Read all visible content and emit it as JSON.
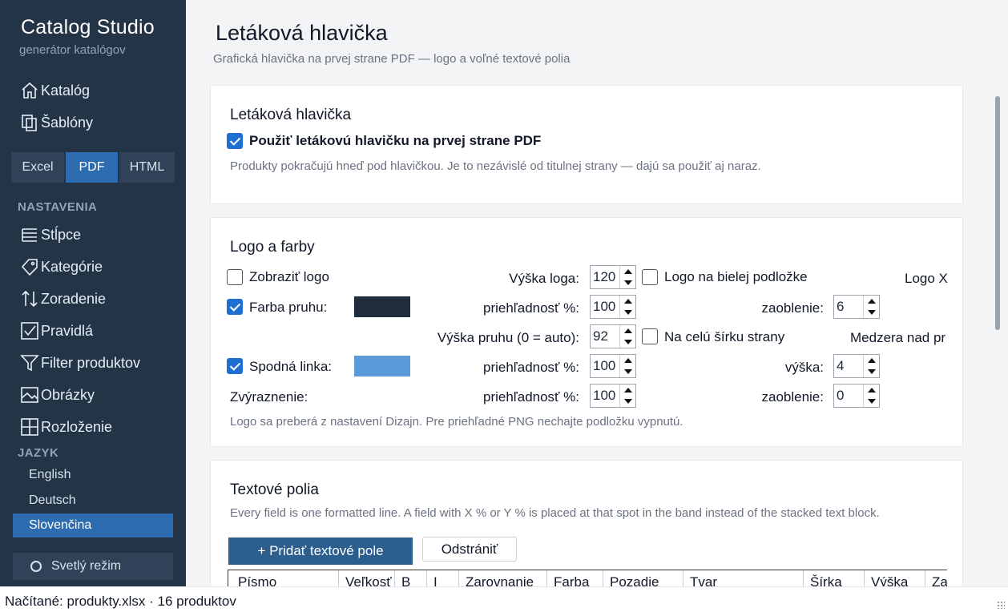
{
  "app": {
    "title": "Catalog Studio",
    "subtitle": "generátor katalógov"
  },
  "nav_top": [
    {
      "label": "Katalóg",
      "icon": "home-icon"
    },
    {
      "label": "Šablóny",
      "icon": "copy-icon"
    }
  ],
  "format_tabs": [
    {
      "label": "Excel",
      "active": false
    },
    {
      "label": "PDF",
      "active": true
    },
    {
      "label": "HTML",
      "active": false
    }
  ],
  "section_settings": "NASTAVENIA",
  "nav_settings": [
    {
      "label": "Stĺpce",
      "icon": "list-icon"
    },
    {
      "label": "Kategórie",
      "icon": "tag-icon"
    },
    {
      "label": "Zoradenie",
      "icon": "sort-icon"
    },
    {
      "label": "Pravidlá",
      "icon": "checkbox-icon"
    },
    {
      "label": "Filter produktov",
      "icon": "filter-icon"
    },
    {
      "label": "Obrázky",
      "icon": "image-icon"
    },
    {
      "label": "Rozloženie",
      "icon": "grid-icon"
    }
  ],
  "section_language": "JAZYK",
  "languages": [
    {
      "label": "English",
      "active": false
    },
    {
      "label": "Deutsch",
      "active": false
    },
    {
      "label": "Slovenčina",
      "active": true
    }
  ],
  "theme_button": "Svetlý režim",
  "page": {
    "title": "Letáková hlavička",
    "subtitle": "Grafická hlavička na prvej strane PDF — logo a voľné textové polia"
  },
  "card1": {
    "title": "Letáková hlavička",
    "checkbox_label": "Použiť letákovú hlavičku na prvej strane PDF",
    "checked": true,
    "hint": "Produkty pokračujú hneď pod hlavičkou. Je to nezávislé od titulnej strany — dajú sa použiť aj naraz."
  },
  "card2": {
    "title": "Logo a farby",
    "show_logo": {
      "label": "Zobraziť logo",
      "checked": false
    },
    "logo_height": {
      "label": "Výška loga:",
      "value": "120"
    },
    "logo_white_bg": {
      "label": "Logo na bielej podložke",
      "checked": false
    },
    "logo_x_label": "Logo X",
    "bar_color": {
      "label": "Farba pruhu:",
      "checked": true,
      "color": "#1f2d3d"
    },
    "bar_opacity": {
      "label": "priehľadnosť %:",
      "value": "100"
    },
    "bar_rounding": {
      "label": "zaoblenie:",
      "value": "6"
    },
    "bar_height": {
      "label": "Výška pruhu (0 = auto):",
      "value": "92"
    },
    "full_width": {
      "label": "Na celú šírku strany",
      "checked": false
    },
    "gap_label": "Medzera nad pr",
    "bottom_line": {
      "label": "Spodná linka:",
      "checked": true,
      "color": "#5b9ad9"
    },
    "line_opacity": {
      "label": "priehľadnosť %:",
      "value": "100"
    },
    "line_height": {
      "label": "výška:",
      "value": "4"
    },
    "highlight": {
      "label": "Zvýraznenie:"
    },
    "highlight_opacity": {
      "label": "priehľadnosť %:",
      "value": "100"
    },
    "highlight_rounding": {
      "label": "zaoblenie:",
      "value": "0"
    },
    "hint": "Logo sa preberá z nastavení Dizajn. Pre priehľadné PNG nechajte podložku vypnutú."
  },
  "card3": {
    "title": "Textové polia",
    "hint": "Every field is one formatted line. A field with X % or Y % is placed at that spot in the band instead of the stacked text block.",
    "add_button": "+ Pridať textové pole",
    "remove_button": "Odstrániť",
    "columns": [
      "Písmo",
      "Veľkosť",
      "B",
      "I",
      "Zarovnanie",
      "Farba",
      "Pozadie",
      "Tvar",
      "Šírka",
      "Výška",
      "Za"
    ]
  },
  "status": "Načítané: produkty.xlsx · 16 produktov"
}
